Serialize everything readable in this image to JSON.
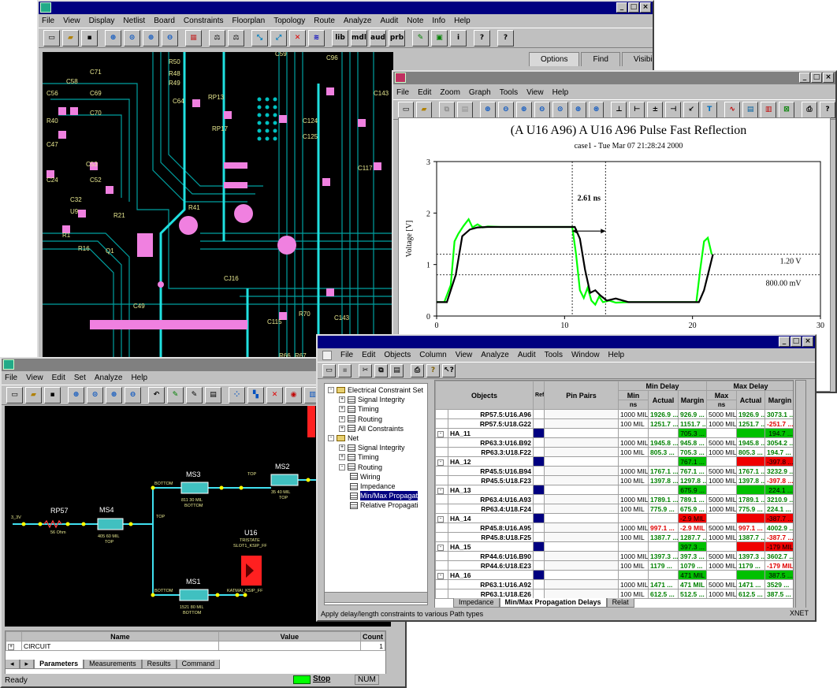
{
  "layout_tool": {
    "menus": [
      "File",
      "View",
      "Display",
      "Netlist",
      "Board",
      "Constraints",
      "Floorplan",
      "Topology",
      "Route",
      "Analyze",
      "Audit",
      "Note",
      "Info",
      "Help"
    ],
    "toolbar": [
      "lib",
      "mdl",
      "aud",
      "prb"
    ],
    "side_tabs": [
      "Options",
      "Find",
      "Visibility"
    ],
    "pcb_labels": [
      "R50",
      "R48",
      "R49",
      "R45",
      "C64",
      "C71",
      "C69",
      "C70",
      "C58",
      "C56",
      "R40",
      "C47",
      "C24",
      "C53",
      "C52",
      "C32",
      "R21",
      "R16",
      "R1",
      "U9",
      "Q1",
      "R41",
      "C124",
      "C125",
      "C117",
      "CJ16",
      "C49",
      "C115",
      "C143",
      "R70",
      "R66",
      "R67",
      "RP17",
      "C59",
      "RP13",
      "C96",
      "C143"
    ]
  },
  "waveform": {
    "menus": [
      "File",
      "Edit",
      "Zoom",
      "Graph",
      "Tools",
      "View",
      "Help"
    ],
    "title": "(A U16 A96) A U16 A96 Pulse Fast Reflection",
    "subtitle": "case1 - Tue Mar 07 21:28:24 2000",
    "annotation": "2.61 ns",
    "ref1": "1.20 V",
    "ref2": "800.00 mV",
    "ylabel": "Voltage [V]"
  },
  "schematic": {
    "menus": [
      "File",
      "View",
      "Edit",
      "Set",
      "Analyze",
      "Help"
    ],
    "grid_headers": [
      "Name",
      "Value",
      "Count"
    ],
    "grid_row": {
      "name": "CIRCUIT",
      "value": "",
      "count": "1"
    },
    "tabs": [
      "Parameters",
      "Measurements",
      "Results",
      "Command"
    ],
    "status": "Ready",
    "stop": "Stop",
    "num": "NUM",
    "labels": {
      "rp57": "RP57",
      "rp57v": "56 Ohm",
      "ms4": "MS4",
      "ms4v": "405 60 MIL",
      "ms4l": "TOP",
      "ms3": "MS3",
      "ms3v": "811 30 MIL",
      "ms3l": "BOTTOM",
      "ms2": "MS2",
      "ms2v": "35 40 MIL",
      "ms2l": "TOP",
      "ms1": "MS1",
      "ms1v": "1521 80 MIL",
      "ms1l": "BOTTOM",
      "u16": "U16",
      "u16a": "TRISTATE",
      "u16b": "SLOT1_KSIP_FF",
      "u16c": "KATMAI_KSIP_FF",
      "top": "TOP",
      "bottom": "BOTTOM",
      "v33": "3_3V"
    }
  },
  "constraint": {
    "menus": [
      "File",
      "Edit",
      "Objects",
      "Column",
      "View",
      "Analyze",
      "Audit",
      "Tools",
      "Window",
      "Help"
    ],
    "tree": [
      {
        "t": "Electrical Constraint Set",
        "lvl": 0,
        "box": "-"
      },
      {
        "t": "Signal Integrity",
        "lvl": 1,
        "box": "+"
      },
      {
        "t": "Timing",
        "lvl": 1,
        "box": "+"
      },
      {
        "t": "Routing",
        "lvl": 1,
        "box": "+"
      },
      {
        "t": "All Constraints",
        "lvl": 1,
        "box": "+"
      },
      {
        "t": "Net",
        "lvl": 0,
        "box": "-"
      },
      {
        "t": "Signal Integrity",
        "lvl": 1,
        "box": "+"
      },
      {
        "t": "Timing",
        "lvl": 1,
        "box": "+"
      },
      {
        "t": "Routing",
        "lvl": 1,
        "box": "-"
      },
      {
        "t": "Wiring",
        "lvl": 2
      },
      {
        "t": "Impedance",
        "lvl": 2
      },
      {
        "t": "Min/Max Propagat",
        "lvl": 2,
        "sel": true
      },
      {
        "t": "Relative Propagati",
        "lvl": 2
      }
    ],
    "headers": {
      "objects": "Objects",
      "ref": "Ref",
      "pinpairs": "Pin Pairs",
      "mindelay": "Min Delay",
      "maxdelay": "Max Delay",
      "min": "Min",
      "ns": "ns",
      "max": "Max",
      "actual": "Actual",
      "margin": "Margin"
    },
    "rows": [
      {
        "g": 0,
        "o": "RP57.5:U16.A96",
        "mn": "1000 MIL",
        "a": "1926.9 ...",
        "m": "926.9 ...",
        "mx": "5000 MIL",
        "a2": "1926.9 ...",
        "m2": "3073.1 ...",
        "mc": "tg",
        "m2c": "tg"
      },
      {
        "g": 0,
        "o": "RP57.5:U18.G22",
        "mn": "100 MIL",
        "a": "1251.7 ...",
        "m": "1151.7 ...",
        "mx": "1000 MIL",
        "a2": "1251.7 ...",
        "m2": "-251.7 ...",
        "mc": "tg",
        "m2c": "tr"
      },
      {
        "g": 1,
        "o": "HA_11",
        "m": "705.3 ...",
        "mcell": "g",
        "m2": "194.7 ...",
        "m2cell": "g"
      },
      {
        "g": 0,
        "o": "RP63.3:U16.B92",
        "mn": "1000 MIL",
        "a": "1945.8 ...",
        "m": "945.8 ...",
        "mx": "5000 MIL",
        "a2": "1945.8 ...",
        "m2": "3054.2 ...",
        "mc": "tg",
        "m2c": "tg"
      },
      {
        "g": 0,
        "o": "RP63.3:U18.F22",
        "mn": "100 MIL",
        "a": "805.3 ...",
        "m": "705.3 ...",
        "mx": "1000 MIL",
        "a2": "805.3 ...",
        "m2": "194.7 ...",
        "mc": "tg",
        "m2c": "tg"
      },
      {
        "g": 1,
        "o": "HA_12",
        "m": "767.1 ...",
        "mcell": "g",
        "m2": "-397.8 ...",
        "m2cell": "r"
      },
      {
        "g": 0,
        "o": "RP45.5:U16.B94",
        "mn": "1000 MIL",
        "a": "1767.1 ...",
        "m": "767.1 ...",
        "mx": "5000 MIL",
        "a2": "1767.1 ...",
        "m2": "3232.9 ...",
        "mc": "tg",
        "m2c": "tg"
      },
      {
        "g": 0,
        "o": "RP45.5:U18.F23",
        "mn": "100 MIL",
        "a": "1397.8 ...",
        "m": "1297.8 ...",
        "mx": "1000 MIL",
        "a2": "1397.8 ...",
        "m2": "-397.8 ...",
        "mc": "tg",
        "m2c": "tr"
      },
      {
        "g": 1,
        "o": "HA_13",
        "m": "675.9 ...",
        "mcell": "g",
        "m2": "224.1 ...",
        "m2cell": "g"
      },
      {
        "g": 0,
        "o": "RP63.4:U16.A93",
        "mn": "1000 MIL",
        "a": "1789.1 ...",
        "m": "789.1 ...",
        "mx": "5000 MIL",
        "a2": "1789.1 ...",
        "m2": "3210.9 ...",
        "mc": "tg",
        "m2c": "tg"
      },
      {
        "g": 0,
        "o": "RP63.4:U18.F24",
        "mn": "100 MIL",
        "a": "775.9 ...",
        "m": "675.9 ...",
        "mx": "1000 MIL",
        "a2": "775.9 ...",
        "m2": "224.1 ...",
        "mc": "tg",
        "m2c": "tg"
      },
      {
        "g": 1,
        "o": "HA_14",
        "m": "-2.9 MIL",
        "mcell": "r",
        "m2": "-387.7 ...",
        "m2cell": "r"
      },
      {
        "g": 0,
        "o": "RP45.8:U16.A95",
        "mn": "1000 MIL",
        "a": "997.1 ...",
        "m": "-2.9 MIL",
        "mx": "5000 MIL",
        "a2": "997.1 ...",
        "m2": "4002.9 ...",
        "mc": "tr",
        "m2c": "tg",
        "ac": "tr",
        "a2c": "tr"
      },
      {
        "g": 0,
        "o": "RP45.8:U18.F25",
        "mn": "100 MIL",
        "a": "1387.7 ...",
        "m": "1287.7 ...",
        "mx": "1000 MIL",
        "a2": "1387.7 ...",
        "m2": "-387.7 ...",
        "mc": "tg",
        "m2c": "tr"
      },
      {
        "g": 1,
        "o": "HA_15",
        "m": "397.3 ...",
        "mcell": "g",
        "m2": "-179 MIL",
        "m2cell": "r"
      },
      {
        "g": 0,
        "o": "RP44.6:U16.B90",
        "mn": "1000 MIL",
        "a": "1397.3 ...",
        "m": "397.3 ...",
        "mx": "5000 MIL",
        "a2": "1397.3 ...",
        "m2": "3602.7 ...",
        "mc": "tg",
        "m2c": "tg"
      },
      {
        "g": 0,
        "o": "RP44.6:U18.E23",
        "mn": "100 MIL",
        "a": "1179 ...",
        "m": "1079 ...",
        "mx": "1000 MIL",
        "a2": "1179 ...",
        "m2": "-179 MIL",
        "mc": "tg",
        "m2c": "tr"
      },
      {
        "g": 1,
        "o": "HA_16",
        "m": "471 MIL",
        "mcell": "g",
        "m2": "387.5 ...",
        "m2cell": "g"
      },
      {
        "g": 0,
        "o": "RP63.1:U16.A92",
        "mn": "1000 MIL",
        "a": "1471 ...",
        "m": "471 MIL",
        "mx": "5000 MIL",
        "a2": "1471 ...",
        "m2": "3529 ...",
        "mc": "tg",
        "m2c": "tg"
      },
      {
        "g": 0,
        "o": "RP63.1:U18.E26",
        "mn": "100 MIL",
        "a": "612.5 ...",
        "m": "512.5 ...",
        "mx": "1000 MIL",
        "a2": "612.5 ...",
        "m2": "387.5 ...",
        "mc": "tg",
        "m2c": "tg"
      }
    ],
    "tabs": [
      "Impedance",
      "Min/Max Propagation Delays",
      "Relat"
    ],
    "status": "Apply delay/length constraints to various Path types",
    "status_right": "XNET"
  },
  "chart_data": {
    "type": "line",
    "title": "(A U16 A96) A U16 A96 Pulse Fast Reflection",
    "subtitle": "case1 - Tue Mar 07 21:28:24 2000",
    "ylabel": "Voltage [V]",
    "xlim": [
      0,
      30
    ],
    "ylim": [
      0,
      3
    ],
    "x_ticks": [
      0,
      10,
      20,
      30
    ],
    "y_ticks": [
      0,
      1,
      2,
      3
    ],
    "series": [
      {
        "color": "#00ff00",
        "x": [
          0,
          0.6,
          1.1,
          1.4,
          1.7,
          2.1,
          2.5,
          2.8,
          3.2,
          3.6,
          4,
          5,
          8,
          10.6,
          10.9,
          11.2,
          11.5,
          11.8,
          12.1,
          12.4,
          12.7,
          13,
          13.5,
          14,
          15,
          18,
          20.3,
          20.6,
          20.9,
          21.2,
          21.5
        ],
        "y": [
          0.27,
          0.27,
          0.6,
          1.45,
          1.6,
          1.75,
          1.88,
          1.72,
          1.78,
          1.72,
          1.74,
          1.73,
          1.73,
          1.73,
          1.2,
          0.5,
          0.35,
          0.55,
          0.3,
          0.22,
          0.38,
          0.27,
          0.3,
          0.26,
          0.27,
          0.27,
          0.27,
          0.9,
          1.45,
          1.52,
          1.2
        ],
        "y_note": "approx"
      },
      {
        "color": "#000000",
        "x": [
          0,
          0.8,
          1.5,
          2,
          2.6,
          3.2,
          4,
          6,
          10.8,
          11.2,
          11.6,
          12,
          12.4,
          12.8,
          13.3,
          14,
          15,
          16,
          18,
          20.5,
          20.9,
          21.3,
          21.6
        ],
        "y": [
          0.27,
          0.27,
          0.8,
          1.55,
          1.68,
          1.72,
          1.73,
          1.73,
          1.73,
          1.5,
          0.9,
          0.45,
          0.5,
          0.4,
          0.3,
          0.34,
          0.27,
          0.27,
          0.27,
          0.27,
          0.5,
          0.9,
          1.2
        ]
      }
    ],
    "annotations": [
      "2.61 ns",
      "1.20 V",
      "800.00 mV"
    ],
    "hlines": [
      1.2,
      0.8
    ],
    "vlines": [
      10.6,
      13.2
    ]
  }
}
